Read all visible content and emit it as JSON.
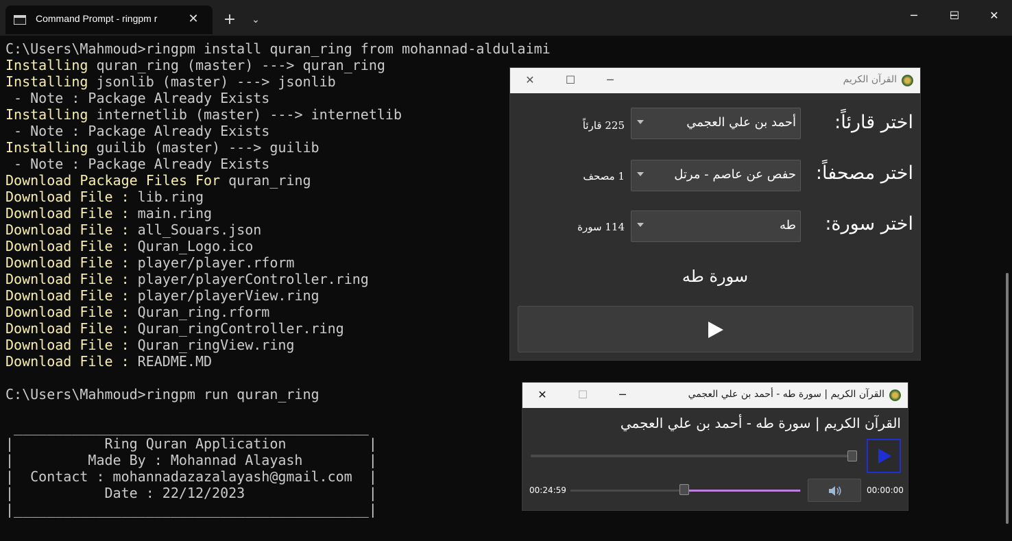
{
  "terminal": {
    "tab_title": "Command Prompt - ringpm  r",
    "tab_close": "✕",
    "new_tab": "+",
    "tab_menu": "⌄",
    "window_controls": {
      "minimize": "─",
      "maximize": "☐",
      "close": "✕"
    },
    "lines": [
      [
        {
          "t": "C:\\Users\\Mahmoud>ringpm install quran_ring from mohannad-aldulaimi",
          "k": 0
        }
      ],
      [
        {
          "t": "Installing",
          "k": 1
        },
        {
          "t": " quran_ring (master) ---> quran_ring",
          "k": 0
        }
      ],
      [
        {
          "t": "Installing",
          "k": 1
        },
        {
          "t": " jsonlib (master) ---> jsonlib",
          "k": 0
        }
      ],
      [
        {
          "t": " - Note : Package Already Exists",
          "k": 0
        }
      ],
      [
        {
          "t": "Installing",
          "k": 1
        },
        {
          "t": " internetlib (master) ---> internetlib",
          "k": 0
        }
      ],
      [
        {
          "t": " - Note : Package Already Exists",
          "k": 0
        }
      ],
      [
        {
          "t": "Installing",
          "k": 1
        },
        {
          "t": " guilib (master) ---> guilib",
          "k": 0
        }
      ],
      [
        {
          "t": " - Note : Package Already Exists",
          "k": 0
        }
      ],
      [
        {
          "t": "Download Package Files For",
          "k": 1
        },
        {
          "t": " quran_ring",
          "k": 0
        }
      ],
      [
        {
          "t": "Download File :",
          "k": 1
        },
        {
          "t": " lib.ring",
          "k": 0
        }
      ],
      [
        {
          "t": "Download File :",
          "k": 1
        },
        {
          "t": " main.ring",
          "k": 0
        }
      ],
      [
        {
          "t": "Download File :",
          "k": 1
        },
        {
          "t": " all_Souars.json",
          "k": 0
        }
      ],
      [
        {
          "t": "Download File :",
          "k": 1
        },
        {
          "t": " Quran_Logo.ico",
          "k": 0
        }
      ],
      [
        {
          "t": "Download File :",
          "k": 1
        },
        {
          "t": " player/player.rform",
          "k": 0
        }
      ],
      [
        {
          "t": "Download File :",
          "k": 1
        },
        {
          "t": " player/playerController.ring",
          "k": 0
        }
      ],
      [
        {
          "t": "Download File :",
          "k": 1
        },
        {
          "t": " player/playerView.ring",
          "k": 0
        }
      ],
      [
        {
          "t": "Download File :",
          "k": 1
        },
        {
          "t": " Quran_ring.rform",
          "k": 0
        }
      ],
      [
        {
          "t": "Download File :",
          "k": 1
        },
        {
          "t": " Quran_ringController.ring",
          "k": 0
        }
      ],
      [
        {
          "t": "Download File :",
          "k": 1
        },
        {
          "t": " Quran_ringView.ring",
          "k": 0
        }
      ],
      [
        {
          "t": "Download File :",
          "k": 1
        },
        {
          "t": " README.MD",
          "k": 0
        }
      ],
      [
        {
          "t": "",
          "k": 0
        }
      ],
      [
        {
          "t": "C:\\Users\\Mahmoud>ringpm run quran_ring",
          "k": 0
        }
      ],
      [
        {
          "t": "",
          "k": 0
        }
      ],
      [
        {
          "t": " ___________________________________________",
          "k": 0
        }
      ],
      [
        {
          "t": "|           Ring Quran Application          |",
          "k": 0
        }
      ],
      [
        {
          "t": "|         Made By : Mohannad Alayash        |",
          "k": 0
        }
      ],
      [
        {
          "t": "|  Contact : mohannadazazalayash@gmail.com  |",
          "k": 0
        }
      ],
      [
        {
          "t": "|           Date : 22/12/2023               |",
          "k": 0
        }
      ],
      [
        {
          "t": "|___________________________________________|",
          "k": 0
        }
      ]
    ]
  },
  "quran_window": {
    "title": "القرآن الكريم",
    "controls": {
      "close": "✕",
      "maximize": "☐",
      "minimize": "─"
    },
    "reciter": {
      "label": "اختر قارئاً:",
      "value": "أحمد بن علي العجمي",
      "count": "225 قارئاً"
    },
    "mushaf": {
      "label": "اختر مصحفاً:",
      "value": "حفص عن عاصم - مرتل",
      "count": "1 مصحف"
    },
    "surah": {
      "label": "اختر سورة:",
      "value": "طه",
      "count": "114 سورة"
    },
    "selected_surah": "سورة طه",
    "play_button": "play-icon"
  },
  "player_window": {
    "title": "القرآن الكريم | سورة طه - أحمد بن علي العجمي",
    "controls": {
      "close": "✕",
      "maximize": "☐",
      "minimize": "─"
    },
    "now_playing": "القرآن الكريم | سورة طه - أحمد بن علي العجمي",
    "seek_position": 1.0,
    "elapsed": "00:24:59",
    "remaining": "00:00:00",
    "volume_level": 0.48,
    "accent_color": "#1f2fd6",
    "volume_color": "#c080e0"
  }
}
